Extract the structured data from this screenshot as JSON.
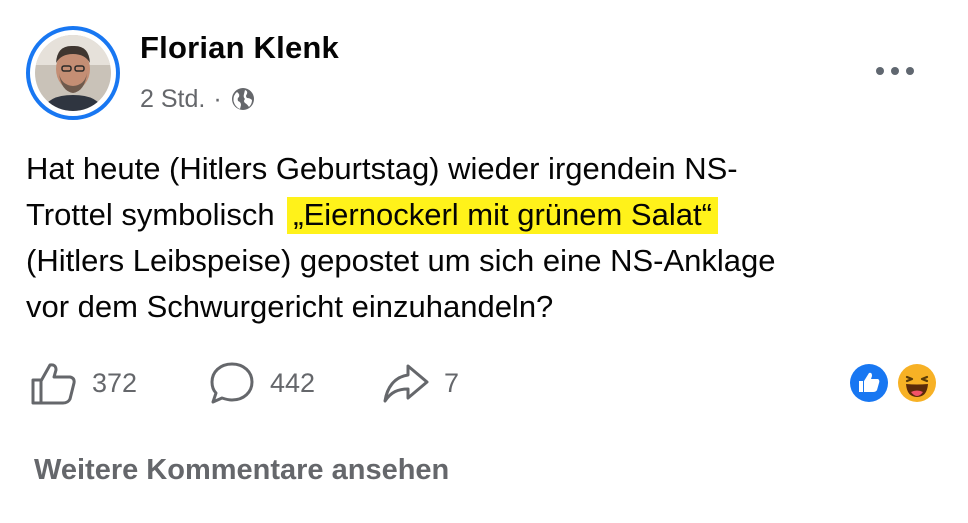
{
  "post": {
    "author": "Florian Klenk",
    "time": "2 Std.",
    "separator": "·",
    "audience_icon": "globe-icon",
    "more_icon": "more-options-icon",
    "text_lines": {
      "line1": "Hat heute (Hitlers Geburtstag) wieder irgendein NS-",
      "line2_before": "Trottel symbolisch",
      "line2_highlight": "„Eiernockerl mit grünem Salat“",
      "line3": "(Hitlers Leibspeise) gepostet um sich eine NS-Anklage",
      "line4": "vor dem Schwurgericht einzuhandeln?"
    },
    "highlight_color": "#fff21a"
  },
  "actions": {
    "like_count": "372",
    "comment_count": "442",
    "share_count": "7"
  },
  "reactions": {
    "items": [
      "like-reaction-icon",
      "haha-reaction-icon"
    ],
    "like_color": "#1877f2",
    "haha_color": "#f7b125"
  },
  "comments": {
    "more_label": "Weitere Kommentare ansehen"
  },
  "theme": {
    "accent": "#1877f2",
    "text": "#050505",
    "muted": "#65676b"
  }
}
